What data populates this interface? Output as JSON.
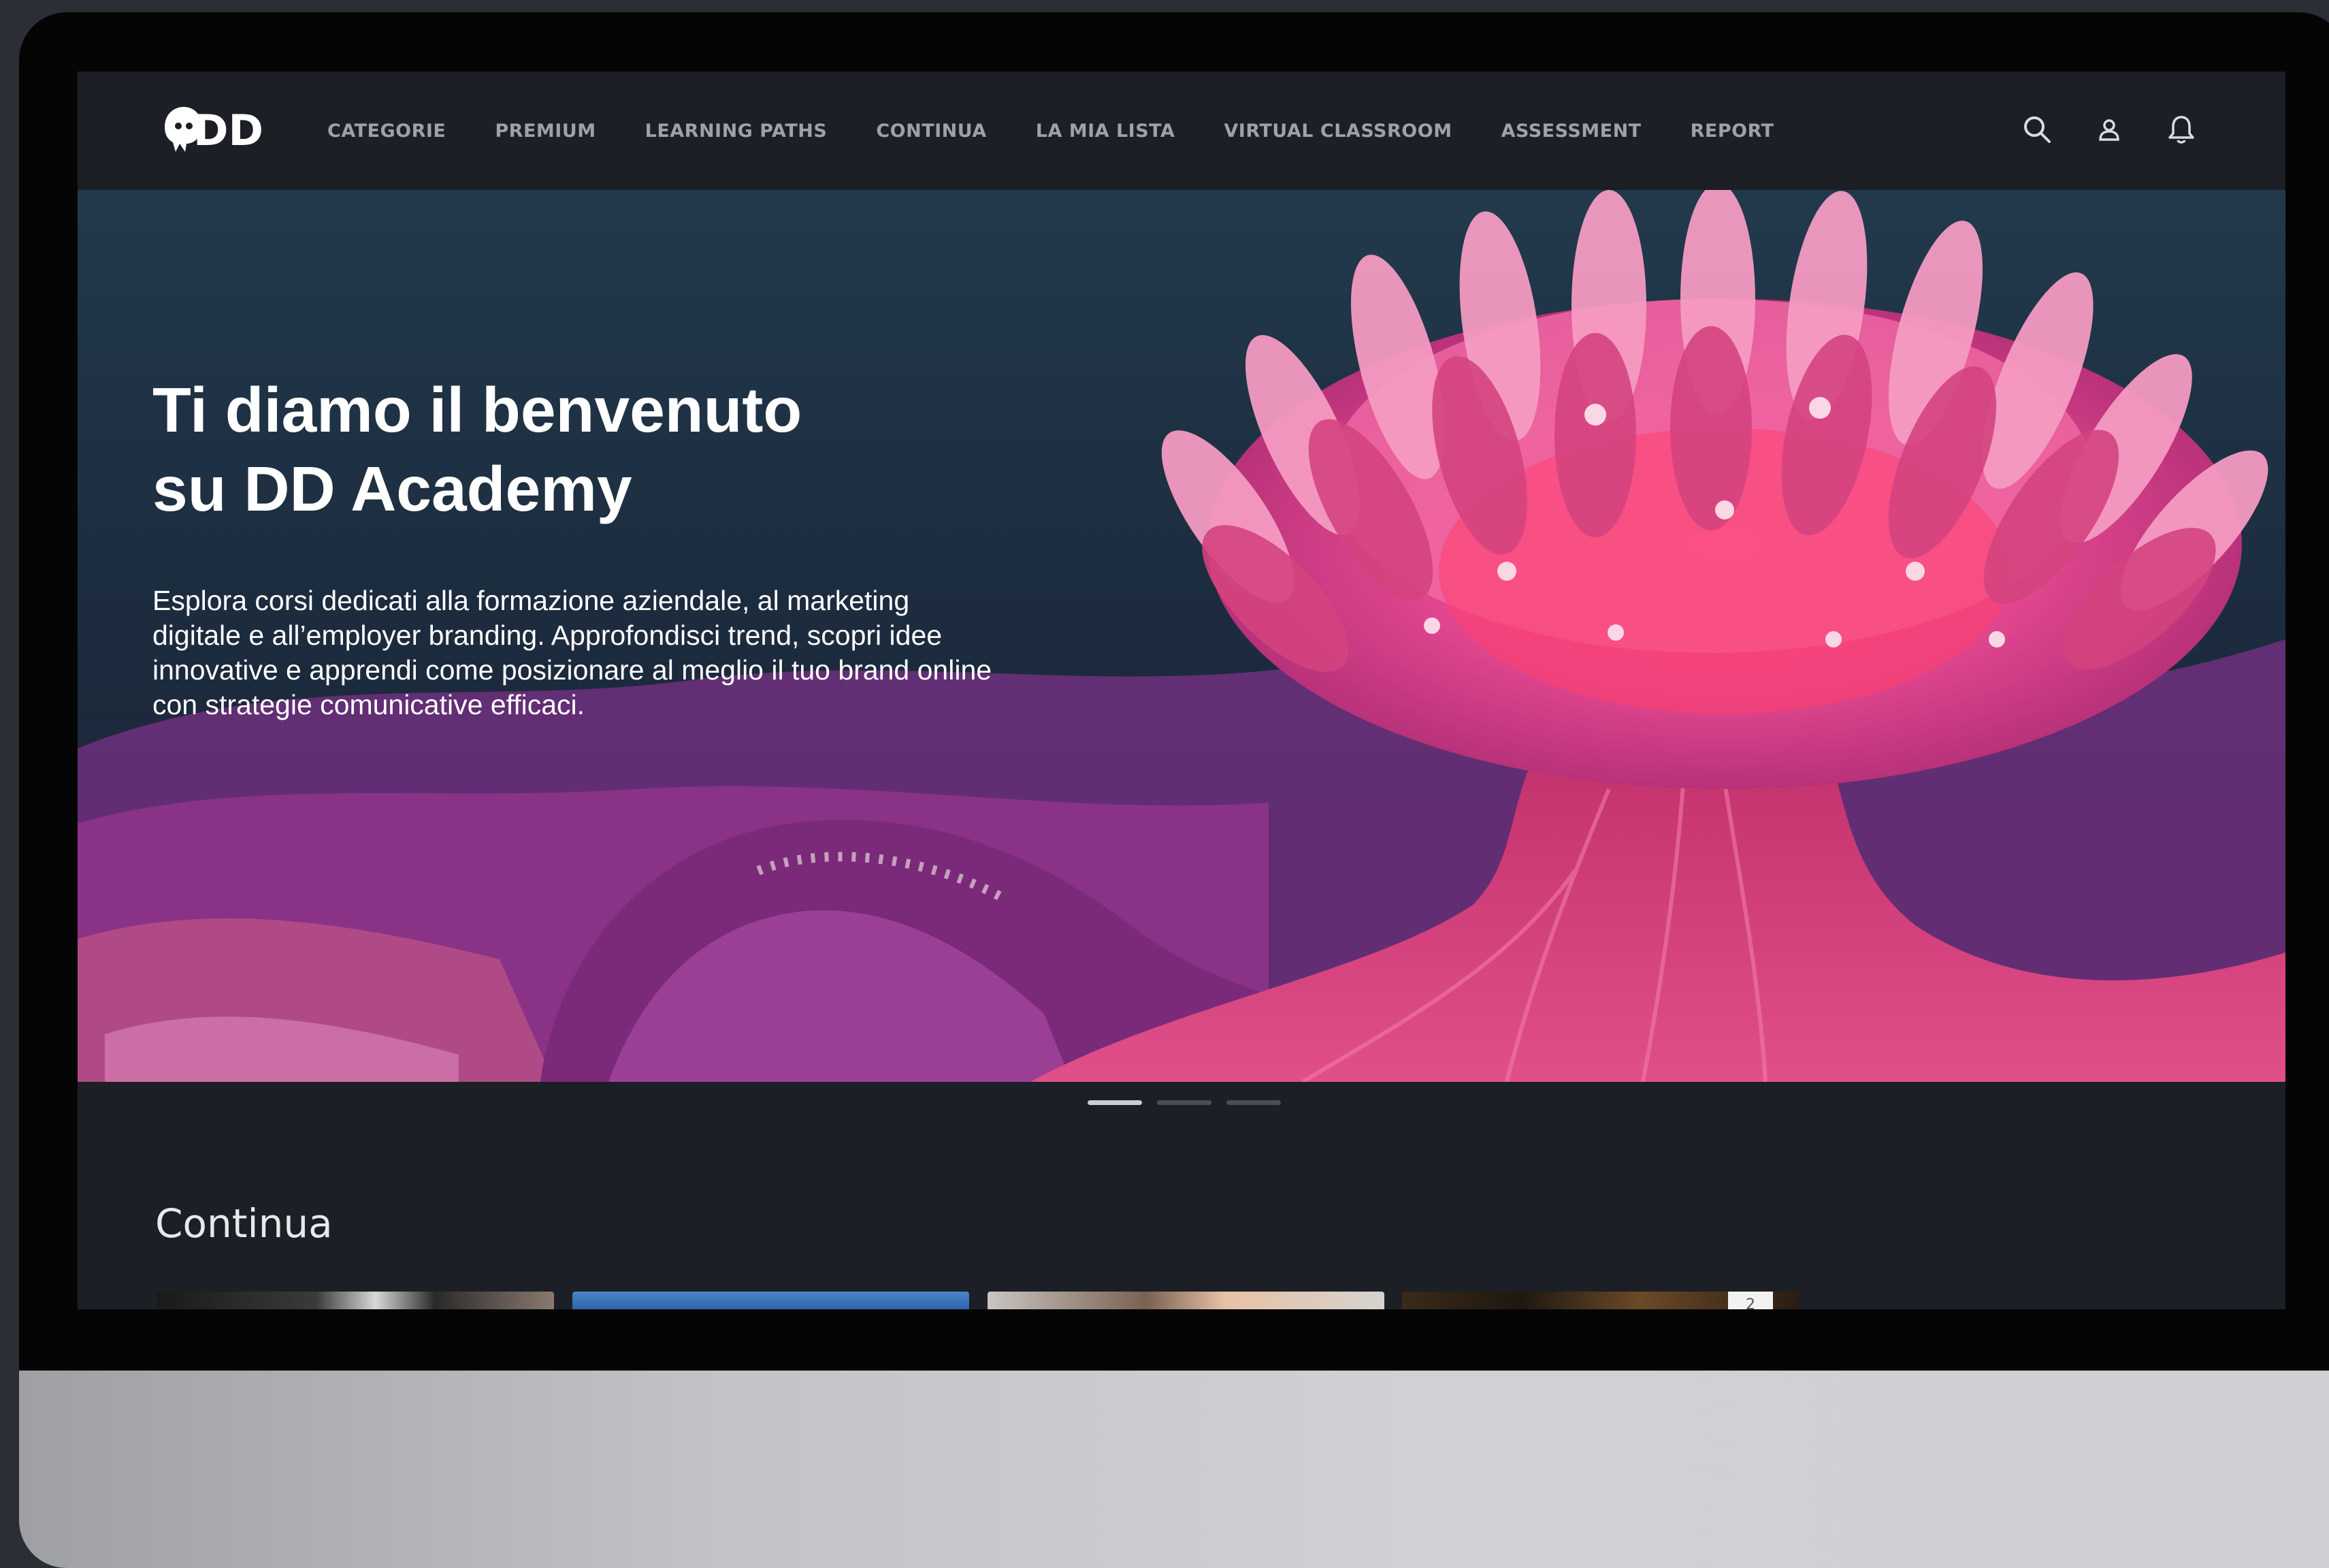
{
  "brand": {
    "logo_text": "DD"
  },
  "nav": {
    "items": [
      {
        "label": "CATEGORIE"
      },
      {
        "label": "PREMIUM"
      },
      {
        "label": "LEARNING PATHS"
      },
      {
        "label": "CONTINUA"
      },
      {
        "label": "LA MIA LISTA"
      },
      {
        "label": "VIRTUAL CLASSROOM"
      },
      {
        "label": "ASSESSMENT"
      },
      {
        "label": "REPORT"
      }
    ],
    "icons": [
      "search-icon",
      "user-icon",
      "bell-icon"
    ]
  },
  "hero": {
    "title_line1": "Ti diamo il benvenuto",
    "title_line2": "su DD Academy",
    "description": "Esplora corsi dedicati alla formazione aziendale, al marketing digitale e all’employer branding. Approfondisci trend, scopri idee innovative e apprendi come posizionare al meglio il tuo brand online con strategie comunicative efficaci.",
    "slides_total": 3,
    "active_slide": 1
  },
  "continua": {
    "title": "Continua",
    "cards_visible": 4,
    "last_card_badge": "2"
  },
  "colors": {
    "background": "#1c1f25",
    "nav_text": "#9ea2a8",
    "accent_pink": "#e0387f",
    "hero_sky": "#1f3345"
  }
}
